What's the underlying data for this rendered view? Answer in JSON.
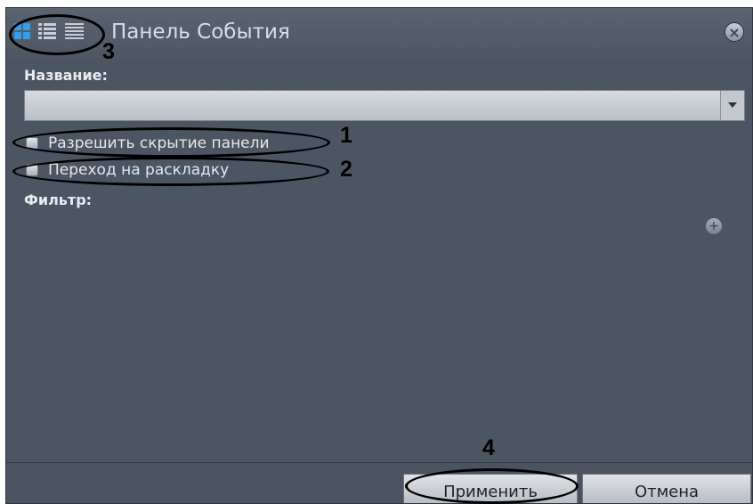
{
  "header": {
    "title": "Панель События",
    "close_label": "×",
    "mode_icons": [
      "grid-view-icon",
      "list-view-icon",
      "compact-list-icon"
    ]
  },
  "form": {
    "name_label": "Название:",
    "name_value": "",
    "checkbox_hide": "Разрешить скрытие панели",
    "checkbox_layout": "Переход на раскладку",
    "filter_label": "Фильтр:",
    "add_filter_label": "+"
  },
  "footer": {
    "apply_label": "Применить",
    "cancel_label": "Отмена"
  },
  "annotations": {
    "n1": "1",
    "n2": "2",
    "n3": "3",
    "n4": "4"
  },
  "colors": {
    "panel_bg": "#4c5562",
    "accent_blue": "#2f9df0",
    "text_light": "#e4e8ed"
  }
}
